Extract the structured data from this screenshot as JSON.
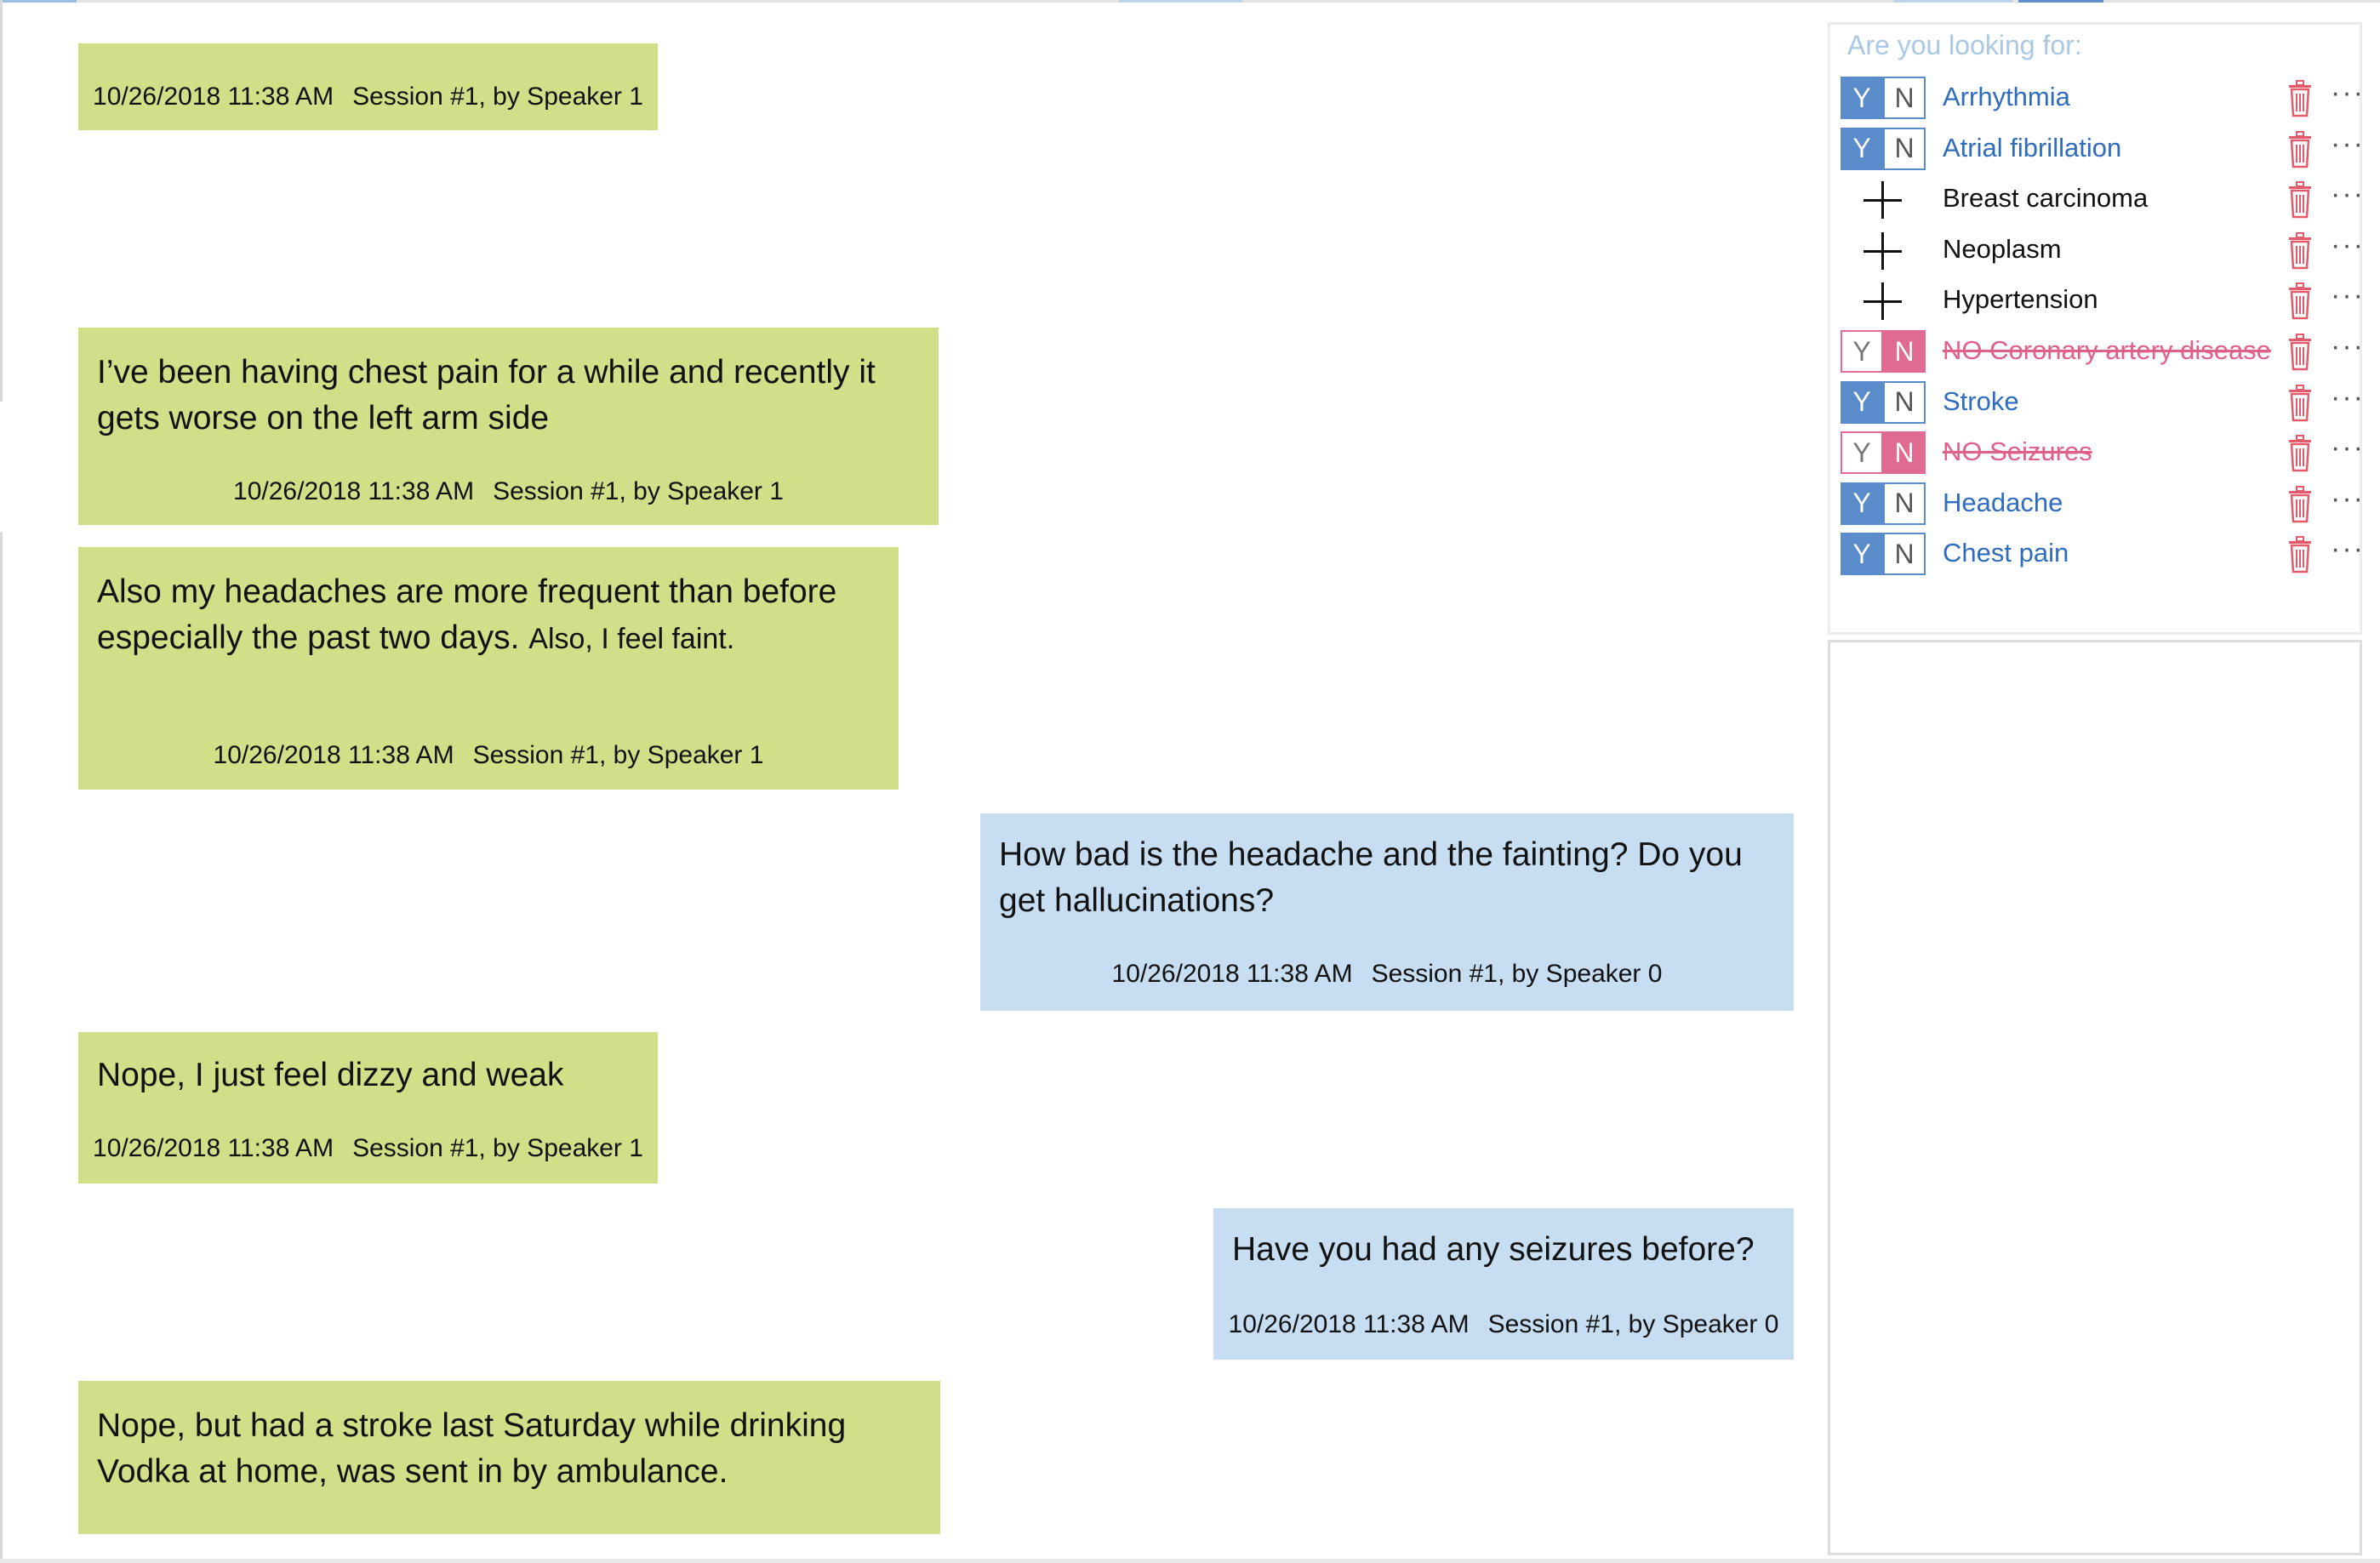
{
  "chat": {
    "messages": [
      {
        "speaker": "Speaker 1",
        "text": "",
        "timestamp": "10/26/2018 11:38 AM",
        "session": "Session #1, by Speaker 1"
      },
      {
        "speaker": "Speaker 1",
        "text": "I’ve been having chest pain for a while and recently it gets worse on the left arm side",
        "timestamp": "10/26/2018 11:38 AM",
        "session": "Session #1, by Speaker 1"
      },
      {
        "speaker": "Speaker 1",
        "text": "Also my headaches are more frequent than before especially the past two days.",
        "text_extra": "Also, I feel faint.",
        "timestamp": "10/26/2018 11:38 AM",
        "session": "Session #1, by Speaker 1"
      },
      {
        "speaker": "Speaker 0",
        "text": "How bad is the headache and the fainting? Do you get hallucinations?",
        "timestamp": "10/26/2018 11:38 AM",
        "session": "Session #1, by Speaker 0"
      },
      {
        "speaker": "Speaker 1",
        "text": "Nope, I just feel dizzy and weak",
        "timestamp": "10/26/2018 11:38 AM",
        "session": "Session #1, by Speaker 1"
      },
      {
        "speaker": "Speaker 0",
        "text": "Have you had any seizures before?",
        "timestamp": "10/26/2018 11:38 AM",
        "session": "Session #1, by Speaker 0"
      },
      {
        "speaker": "Speaker 1",
        "text": "Nope, but had a stroke last Saturday while drinking Vodka at home, was sent in by ambulance."
      }
    ]
  },
  "panel": {
    "title": "Are you looking for:",
    "yes_label": "Y",
    "no_label": "N",
    "more_label": "···",
    "items": [
      {
        "label": "Arrhythmia",
        "state": "yes"
      },
      {
        "label": "Atrial fibrillation",
        "state": "yes"
      },
      {
        "label": "Breast carcinoma",
        "state": "add"
      },
      {
        "label": "Neoplasm",
        "state": "add"
      },
      {
        "label": "Hypertension",
        "state": "add"
      },
      {
        "label": "NO Coronary artery disease",
        "state": "no"
      },
      {
        "label": "Stroke",
        "state": "yes"
      },
      {
        "label": "NO Seizures",
        "state": "no"
      },
      {
        "label": "Headache",
        "state": "yes"
      },
      {
        "label": "Chest pain",
        "state": "yes"
      }
    ]
  },
  "colors": {
    "patient_bubble": "#d2de88",
    "doctor_bubble": "#c7ddf1",
    "confirmed": "#5a8ccb",
    "negated": "#e06a90",
    "trash": "#e25b6a"
  },
  "icons": {
    "remove": "trash-icon",
    "add": "plus-icon",
    "more": "more-icon"
  }
}
